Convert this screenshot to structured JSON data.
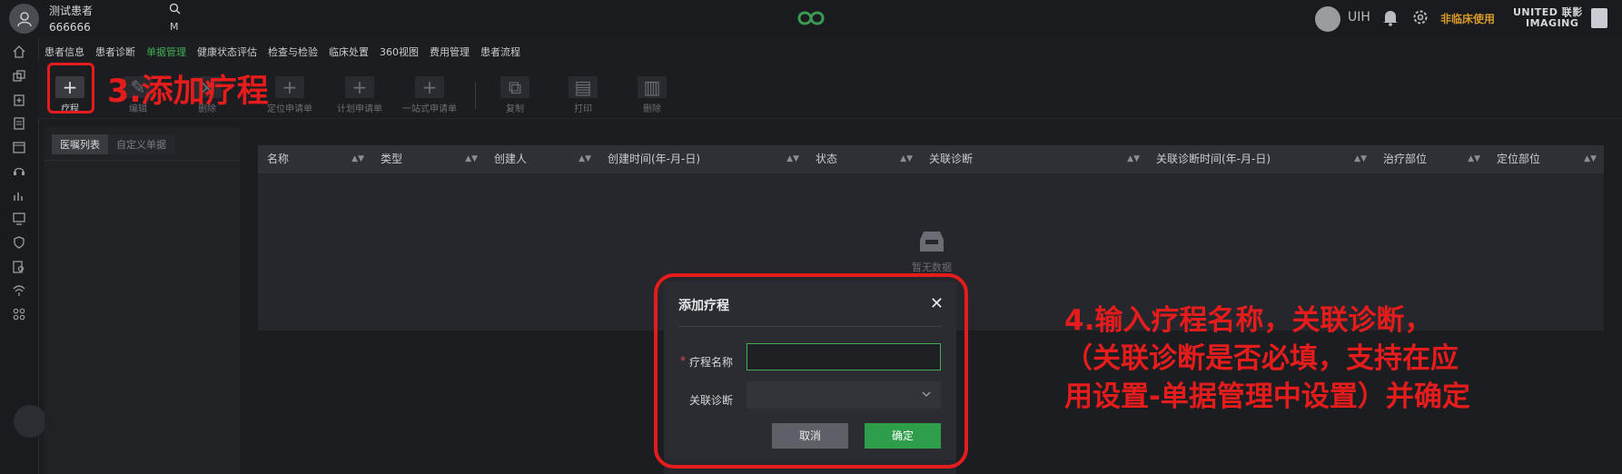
{
  "header": {
    "patient_name": "测试患者",
    "patient_id": "666666",
    "m_label": "M",
    "user_label": "UIH",
    "non_clinical": "非临床使用",
    "brand_line1": "UNITED 联影",
    "brand_line2": "IMAGING"
  },
  "nav_tabs": [
    {
      "label": "患者信息"
    },
    {
      "label": "患者诊断"
    },
    {
      "label": "单据管理"
    },
    {
      "label": "健康状态评估"
    },
    {
      "label": "检查与检验"
    },
    {
      "label": "临床处置"
    },
    {
      "label": "360视图"
    },
    {
      "label": "费用管理"
    },
    {
      "label": "患者流程"
    }
  ],
  "toolbar": {
    "buttons": [
      {
        "label": "疗程"
      },
      {
        "label": "编辑"
      },
      {
        "label": "删除"
      },
      {
        "label": "定位申请单"
      },
      {
        "label": "计划申请单"
      },
      {
        "label": "一站式申请单"
      },
      {
        "label": "复制"
      },
      {
        "label": "打印"
      },
      {
        "label": "删除"
      }
    ]
  },
  "left_panel": {
    "tabs": [
      {
        "label": "医嘱列表"
      },
      {
        "label": "自定义单据"
      }
    ]
  },
  "table": {
    "columns": [
      {
        "label": "名称"
      },
      {
        "label": "类型"
      },
      {
        "label": "创建人"
      },
      {
        "label": "创建时间(年-月-日)"
      },
      {
        "label": "状态"
      },
      {
        "label": "关联诊断"
      },
      {
        "label": "关联诊断时间(年-月-日)"
      },
      {
        "label": "治疗部位"
      },
      {
        "label": "定位部位"
      }
    ],
    "empty_text": "暂无数据"
  },
  "dialog": {
    "title": "添加疗程",
    "close": "✕",
    "field1_required": "*",
    "field1_label": "疗程名称",
    "field1_value": "",
    "field2_label": "关联诊断",
    "field2_value": "",
    "cancel": "取消",
    "ok": "确定"
  },
  "annotations": {
    "step3": "3.添加疗程",
    "step4": "4.输入疗程名称，关联诊断，\n（关联诊断是否必填，支持在应\n用设置-单据管理中设置）并确定"
  },
  "colors": {
    "accent_green": "#3fae55",
    "annotation_red": "#e51c1c",
    "warning_orange": "#d89a28"
  }
}
